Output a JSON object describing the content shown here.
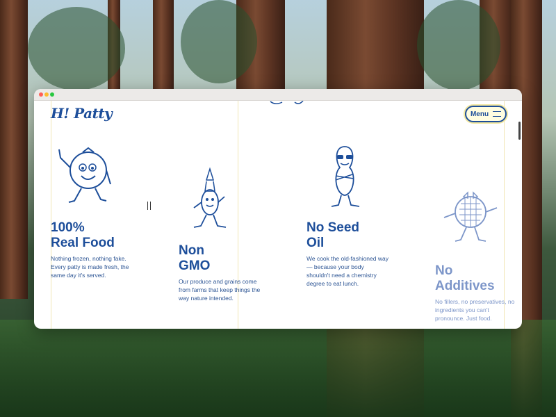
{
  "window": {
    "controls": [
      "close",
      "minimize",
      "maximize"
    ]
  },
  "site": {
    "logo_text": "H! Patty",
    "menu_label": "Menu"
  },
  "features": [
    {
      "title_line1": "100%",
      "title_line2": "Real Food",
      "body": "Nothing frozen, nothing fake. Every patty is made fresh, the same day it's served.",
      "mascot": "tomato-mascot-icon"
    },
    {
      "title_line1": "Non",
      "title_line2": "GMO",
      "body": "Our produce and grains come from farms that keep things the way nature intended.",
      "mascot": "wheat-mascot-icon"
    },
    {
      "title_line1": "No Seed",
      "title_line2": "Oil",
      "body": "We cook the old-fashioned way — because your body shouldn't need a chemistry degree to eat lunch.",
      "mascot": "peanut-mascot-icon"
    },
    {
      "title_line1": "No",
      "title_line2": "Additives",
      "body": "No fillers, no preservatives, no ingredients you can't pronounce. Just food.",
      "mascot": "waffle-mascot-icon"
    }
  ],
  "colors": {
    "brand_blue": "#1d4e9a",
    "faded_blue": "#7d96c9",
    "menu_bg": "#fffde0",
    "guide_line": "#f1e6b5"
  }
}
